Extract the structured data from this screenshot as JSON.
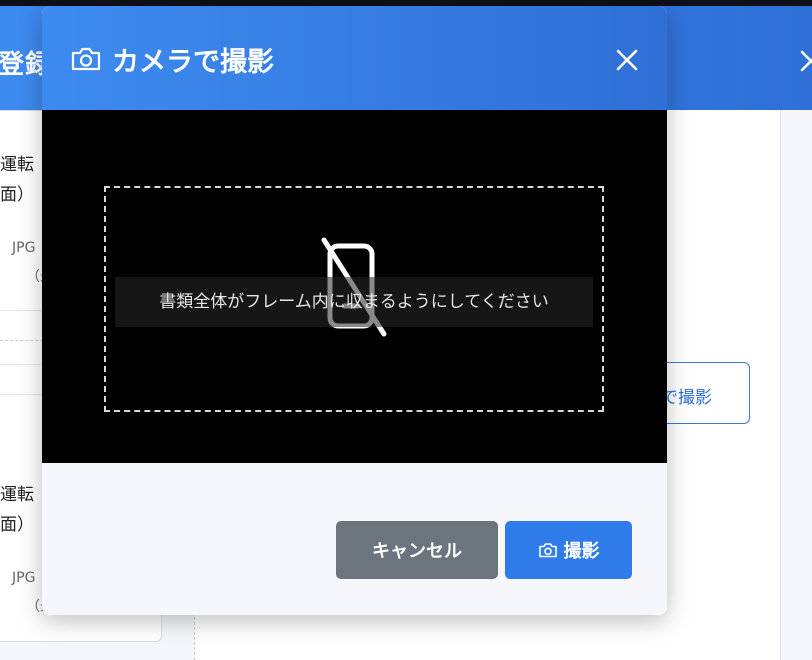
{
  "background": {
    "title_fragment": "登録",
    "card_items": [
      {
        "line1": "運転",
        "line2": "面）",
        "note1": "JPG",
        "note2": "（最"
      },
      {
        "line1": "運転",
        "line2": "面）",
        "note1": "JPG",
        "note2": "（最"
      }
    ],
    "right_button_label": "で撮影"
  },
  "modal": {
    "title": "カメラで撮影",
    "title_icon": "camera-icon",
    "close_icon": "close-icon",
    "viewport": {
      "status_icon": "no-camera-icon",
      "hint": "書類全体がフレーム内に収まるようにしてください"
    },
    "footer": {
      "cancel_label": "キャンセル",
      "capture_label": "撮影",
      "capture_icon": "camera-icon"
    }
  },
  "colors": {
    "header_start": "#3d8bf0",
    "header_end": "#2f6fd6",
    "cancel_button": "#6c757d",
    "capture_button": "#2f7bea"
  }
}
